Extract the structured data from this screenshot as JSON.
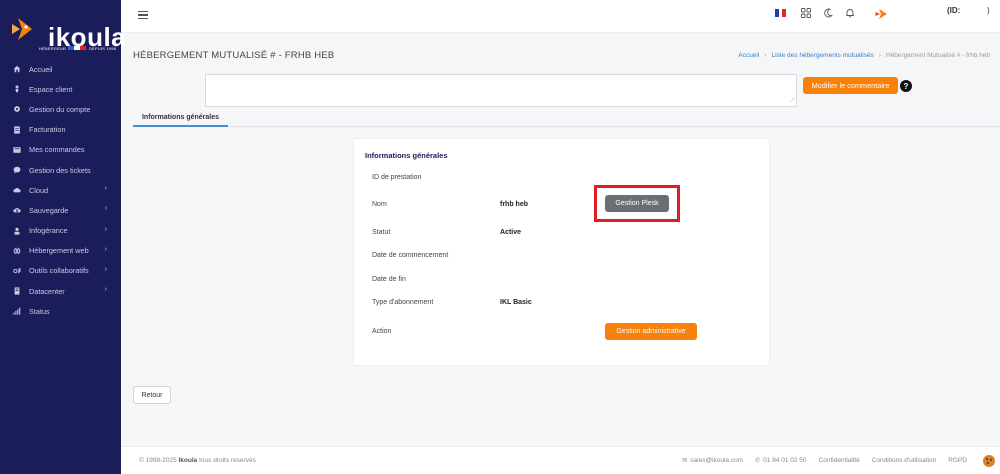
{
  "brand": {
    "name": "ikoula",
    "tagline": "HÉBERGEUR ... DEPUIS 1998",
    "tagline_left": "HÉBERGEUR",
    "tagline_right": "DEPUIS 1998",
    "accent_color": "#f7810b",
    "sidebar_color": "#1b1d5b"
  },
  "sidebar": {
    "items": [
      {
        "label": "Accueil",
        "icon": "home-icon",
        "has_children": false
      },
      {
        "label": "Espace client",
        "icon": "person-icon",
        "has_children": false
      },
      {
        "label": "Gestion du compte",
        "icon": "gear-icon",
        "has_children": false
      },
      {
        "label": "Facturation",
        "icon": "invoice-icon",
        "has_children": false
      },
      {
        "label": "Mes commandes",
        "icon": "inbox-icon",
        "has_children": false
      },
      {
        "label": "Gestion des tickets",
        "icon": "chat-icon",
        "has_children": false
      },
      {
        "label": "Cloud",
        "icon": "cloud-icon",
        "has_children": true
      },
      {
        "label": "Sauvegarde",
        "icon": "backup-icon",
        "has_children": true
      },
      {
        "label": "Infogérance",
        "icon": "support-icon",
        "has_children": true
      },
      {
        "label": "Hébergement web",
        "icon": "globe-icon",
        "has_children": true
      },
      {
        "label": "Outils collaboratifs",
        "icon": "o365-icon",
        "has_children": true
      },
      {
        "label": "Datacenter",
        "icon": "server-icon",
        "has_children": true
      },
      {
        "label": "Status",
        "icon": "signal-icon",
        "has_children": false
      }
    ],
    "chevron": "›"
  },
  "topbar": {
    "user_id_label": "(ID:",
    "user_id_close": ")"
  },
  "page": {
    "title": "HÉBERGEMENT MUTUALISÉ #        - FRHB        HEB",
    "breadcrumb": [
      {
        "label": "Accueil",
        "link": true
      },
      {
        "label": "Liste des hébergements mutualisés",
        "link": true
      },
      {
        "label": "Hébergement Mutualisé #        - frhb        heb",
        "link": false
      }
    ],
    "breadcrumb_sep": "›"
  },
  "comment": {
    "value": "",
    "button_label": "Modifier le commentaire",
    "help": "?"
  },
  "tabs": [
    {
      "label": "Informations générales",
      "active": true
    }
  ],
  "card": {
    "title": "Informations générales",
    "rows": [
      {
        "label": "ID de prestation",
        "value": ""
      },
      {
        "label": "Nom",
        "value": "frhb        heb"
      },
      {
        "label": "Statut",
        "value": "Active"
      },
      {
        "label": "Date de commencement",
        "value": ""
      },
      {
        "label": "Date de fin",
        "value": ""
      },
      {
        "label": "Type d'abonnement",
        "value": "IKL Basic"
      },
      {
        "label": "Action",
        "value": ""
      }
    ],
    "plesk_button": "Gestion Plesk",
    "admin_button": "Gestion administrative",
    "highlight_color": "#e11d24"
  },
  "back_button": "Retour",
  "footer": {
    "copyright_prefix": "© 1998-2025",
    "copyright_brand": "Ikoula",
    "copyright_suffix": "tous droits reservés",
    "email": "sales@ikoula.com",
    "phone": "01 84 01 02 50",
    "links": [
      "Confidentialité",
      "Conditions d'utilisation",
      "RGPD"
    ]
  }
}
